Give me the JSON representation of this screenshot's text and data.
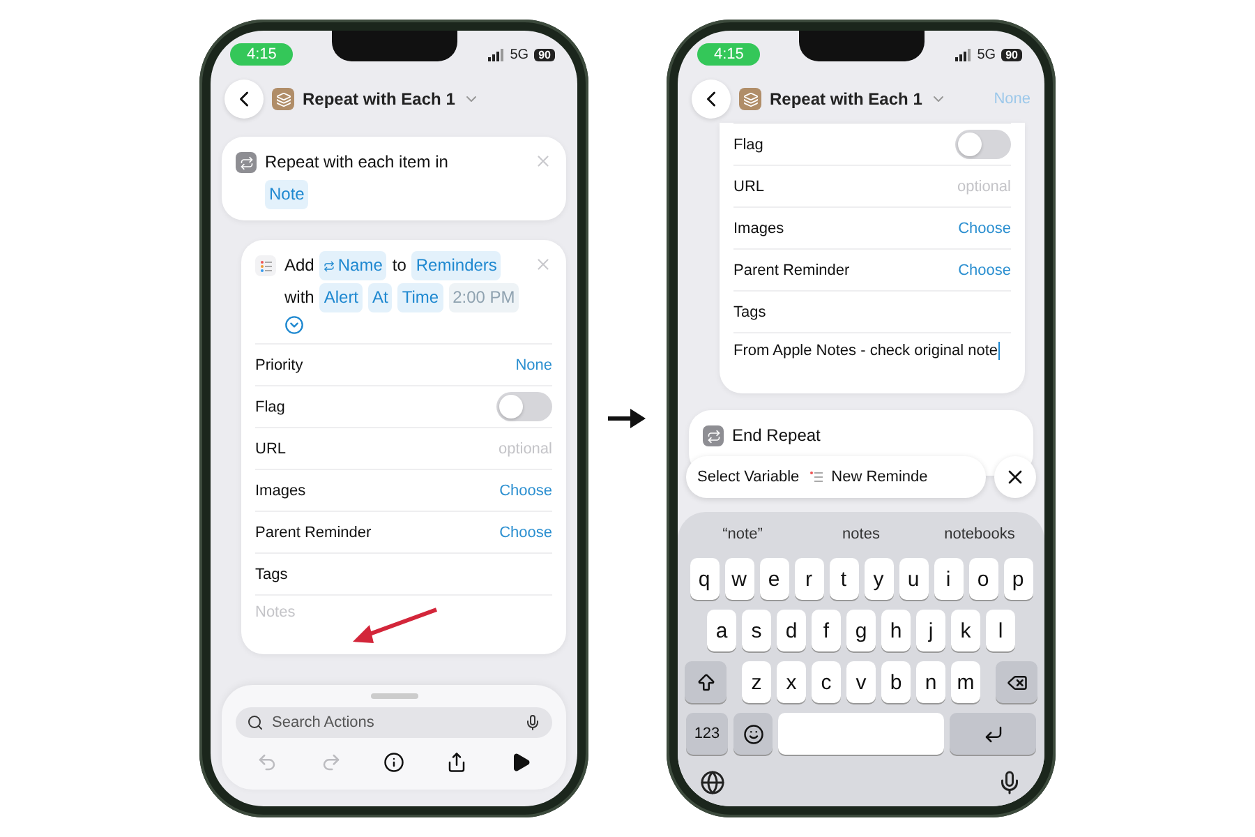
{
  "before_screen": {
    "status_bar": {
      "time": "4:15",
      "network": "5G",
      "battery": "90"
    },
    "nav": {
      "title": "Repeat with Each 1"
    },
    "repeat_card": {
      "text": "Repeat with each item in",
      "token": "Note"
    },
    "action_card": {
      "parts": [
        {
          "kind": "text",
          "text": "Add"
        },
        {
          "kind": "variable",
          "text": "Name"
        },
        {
          "kind": "text",
          "text": "to"
        },
        {
          "kind": "token",
          "text": "Reminders"
        },
        {
          "kind": "text",
          "text": "with"
        },
        {
          "kind": "token",
          "text": "Alert"
        },
        {
          "kind": "token",
          "text": "At"
        },
        {
          "kind": "token",
          "text": "Time"
        },
        {
          "kind": "dim_token",
          "text": "2:00 PM"
        }
      ],
      "rows": [
        {
          "kind": "value",
          "label": "Priority",
          "value": "None"
        },
        {
          "kind": "toggle",
          "label": "Flag",
          "on": false
        },
        {
          "kind": "hint",
          "label": "URL",
          "value": "optional"
        },
        {
          "kind": "value",
          "label": "Images",
          "value": "Choose"
        },
        {
          "kind": "value",
          "label": "Parent Reminder",
          "value": "Choose"
        },
        {
          "kind": "label",
          "label": "Tags"
        },
        {
          "kind": "notes",
          "placeholder": "Notes",
          "focused": false
        }
      ]
    },
    "search": {
      "placeholder": "Search Actions"
    },
    "toolbar": [
      {
        "kind": "undo",
        "disabled": true
      },
      {
        "kind": "redo",
        "disabled": true
      },
      {
        "kind": "info",
        "disabled": false
      },
      {
        "kind": "share",
        "disabled": false
      },
      {
        "kind": "play",
        "disabled": false
      }
    ]
  },
  "after_screen": {
    "status_bar": {
      "time": "4:15",
      "network": "5G",
      "battery": "90"
    },
    "nav": {
      "title": "Repeat with Each 1",
      "trailing": "None"
    },
    "rows": [
      {
        "kind": "toggle",
        "label": "Flag",
        "on": false
      },
      {
        "kind": "hint",
        "label": "URL",
        "value": "optional"
      },
      {
        "kind": "value",
        "label": "Images",
        "value": "Choose"
      },
      {
        "kind": "value",
        "label": "Parent Reminder",
        "value": "Choose"
      },
      {
        "kind": "label",
        "label": "Tags"
      },
      {
        "kind": "notes",
        "value": "From Apple Notes - check original note",
        "focused": true
      }
    ],
    "end_card": {
      "text": "End Repeat"
    },
    "suggestion_bar": {
      "items": [
        "Select Variable",
        "New Reminde"
      ]
    },
    "keyboard": {
      "predictions": [
        "“note”",
        "notes",
        "notebooks"
      ],
      "rows": [
        [
          "q",
          "w",
          "e",
          "r",
          "t",
          "y",
          "u",
          "i",
          "o",
          "p"
        ],
        [
          "a",
          "s",
          "d",
          "f",
          "g",
          "h",
          "j",
          "k",
          "l"
        ],
        [
          "z",
          "x",
          "c",
          "v",
          "b",
          "n",
          "m"
        ]
      ],
      "numbers_key": "123"
    }
  }
}
